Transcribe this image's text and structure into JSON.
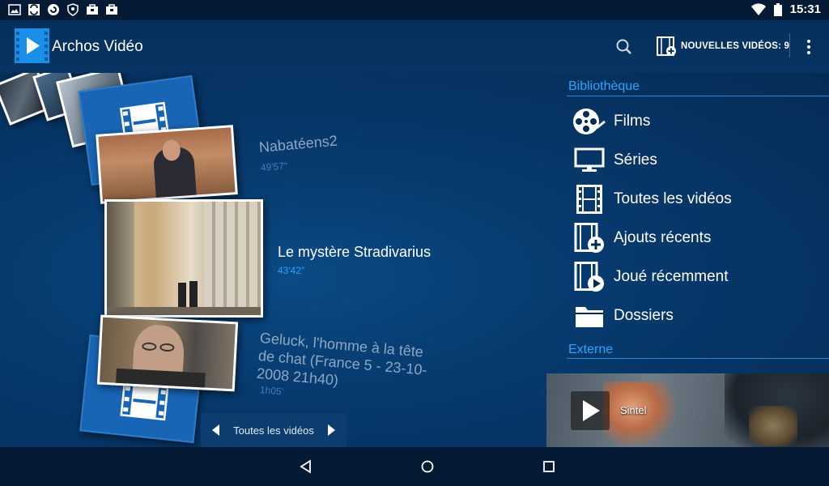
{
  "status_bar": {
    "time": "15:31",
    "left_icons": [
      "gallery-icon",
      "sync-icon",
      "refresh-icon",
      "shield-icon",
      "briefcase-icon",
      "briefcase-icon"
    ],
    "right_icons": [
      "wifi-icon",
      "battery-icon"
    ]
  },
  "app_bar": {
    "title": "Archos Vidéo",
    "new_videos_label": "NOUVELLES VIDÉOS: 9"
  },
  "carousel": {
    "items": [
      {
        "title": "Nabatéens2",
        "duration": "49'57\""
      },
      {
        "title": "Le mystère Stradivarius",
        "duration": "43'42\""
      },
      {
        "title": "Geluck, l'homme à la tête de chat (France 5 - 23-10-2008 21h40)",
        "duration": "1h05'"
      }
    ],
    "nav_label": "Toutes les vidéos"
  },
  "library": {
    "header": "Bibliothèque",
    "items": [
      {
        "label": "Films",
        "icon": "film-reel-icon"
      },
      {
        "label": "Séries",
        "icon": "tv-icon"
      },
      {
        "label": "Toutes les vidéos",
        "icon": "film-strip-icon"
      },
      {
        "label": "Ajouts récents",
        "icon": "film-add-icon"
      },
      {
        "label": "Joué récemment",
        "icon": "film-play-icon"
      },
      {
        "label": "Dossiers",
        "icon": "folder-icon"
      }
    ]
  },
  "external": {
    "header": "Externe",
    "item_label": "Sintel"
  },
  "colors": {
    "background": "#062a52",
    "accent": "#2aa6ff",
    "card_blue": "#1965b5"
  }
}
